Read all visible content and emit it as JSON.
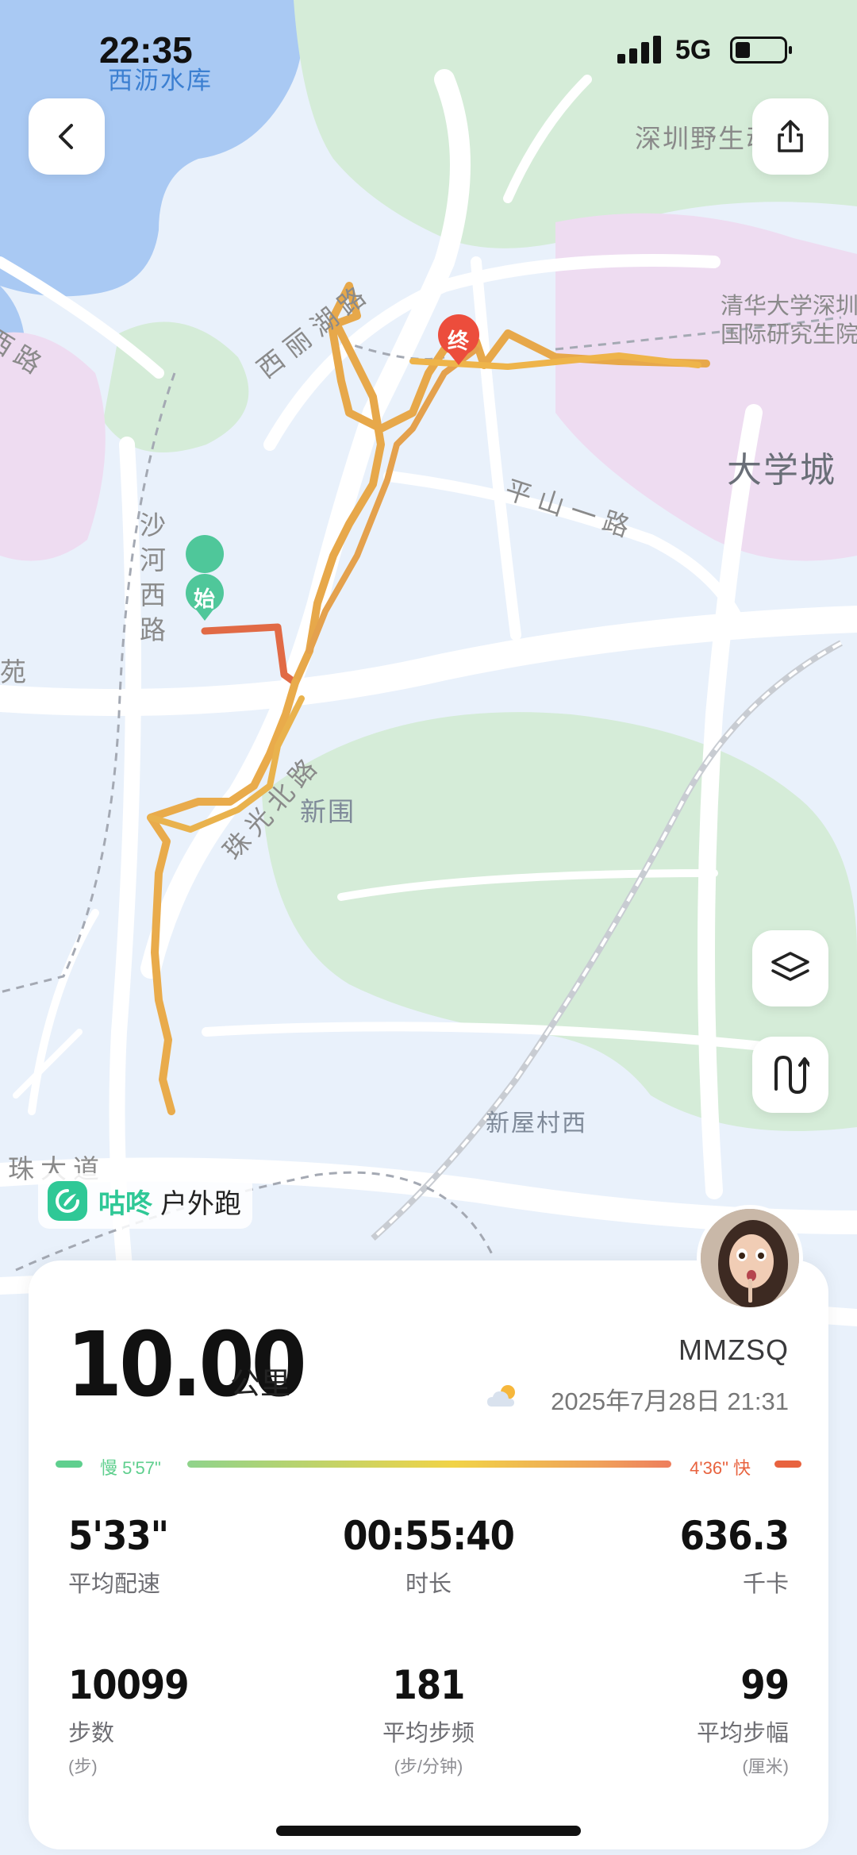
{
  "status_bar": {
    "time": "22:35",
    "network": "5G"
  },
  "map": {
    "labels": {
      "reservoir": "西沥水库",
      "wildlife_park": "深圳野生动物园",
      "tsinghua": "清华大学深圳",
      "intl_institute": "国际研究生院",
      "daxuecheng": "大学城",
      "xilihu_road": "西丽湖路",
      "pingshan_road": "平山一路",
      "shahe_road": "沙河西路",
      "xi_road": "西路",
      "yuan": "苑",
      "xinwei": "新围",
      "zhuguang_road": "珠光北路",
      "xinwucun": "新屋村西",
      "zhu_avenue": "珠大道"
    },
    "start_marker": "始",
    "end_marker": "终",
    "route_colors": {
      "slow": "#e8633f",
      "fast": "#eab24a"
    }
  },
  "brand": {
    "name": "咕咚",
    "activity_type": "户外跑",
    "color": "#2fc896"
  },
  "summary": {
    "distance": "10.00",
    "distance_unit": "公里",
    "username": "MMZSQ",
    "datetime": "2025年7月28日 21:31",
    "pace_bar": {
      "slow_label": "慢 5'57\"",
      "fast_label": "4'36\" 快"
    }
  },
  "stats": [
    {
      "value": "5'33\"",
      "label": "平均配速",
      "unit": ""
    },
    {
      "value": "00:55:40",
      "label": "时长",
      "unit": ""
    },
    {
      "value": "636.3",
      "label": "千卡",
      "unit": ""
    },
    {
      "value": "10099",
      "label": "步数",
      "unit": "(步)"
    },
    {
      "value": "181",
      "label": "平均步频",
      "unit": "(步/分钟)"
    },
    {
      "value": "99",
      "label": "平均步幅",
      "unit": "(厘米)"
    }
  ]
}
